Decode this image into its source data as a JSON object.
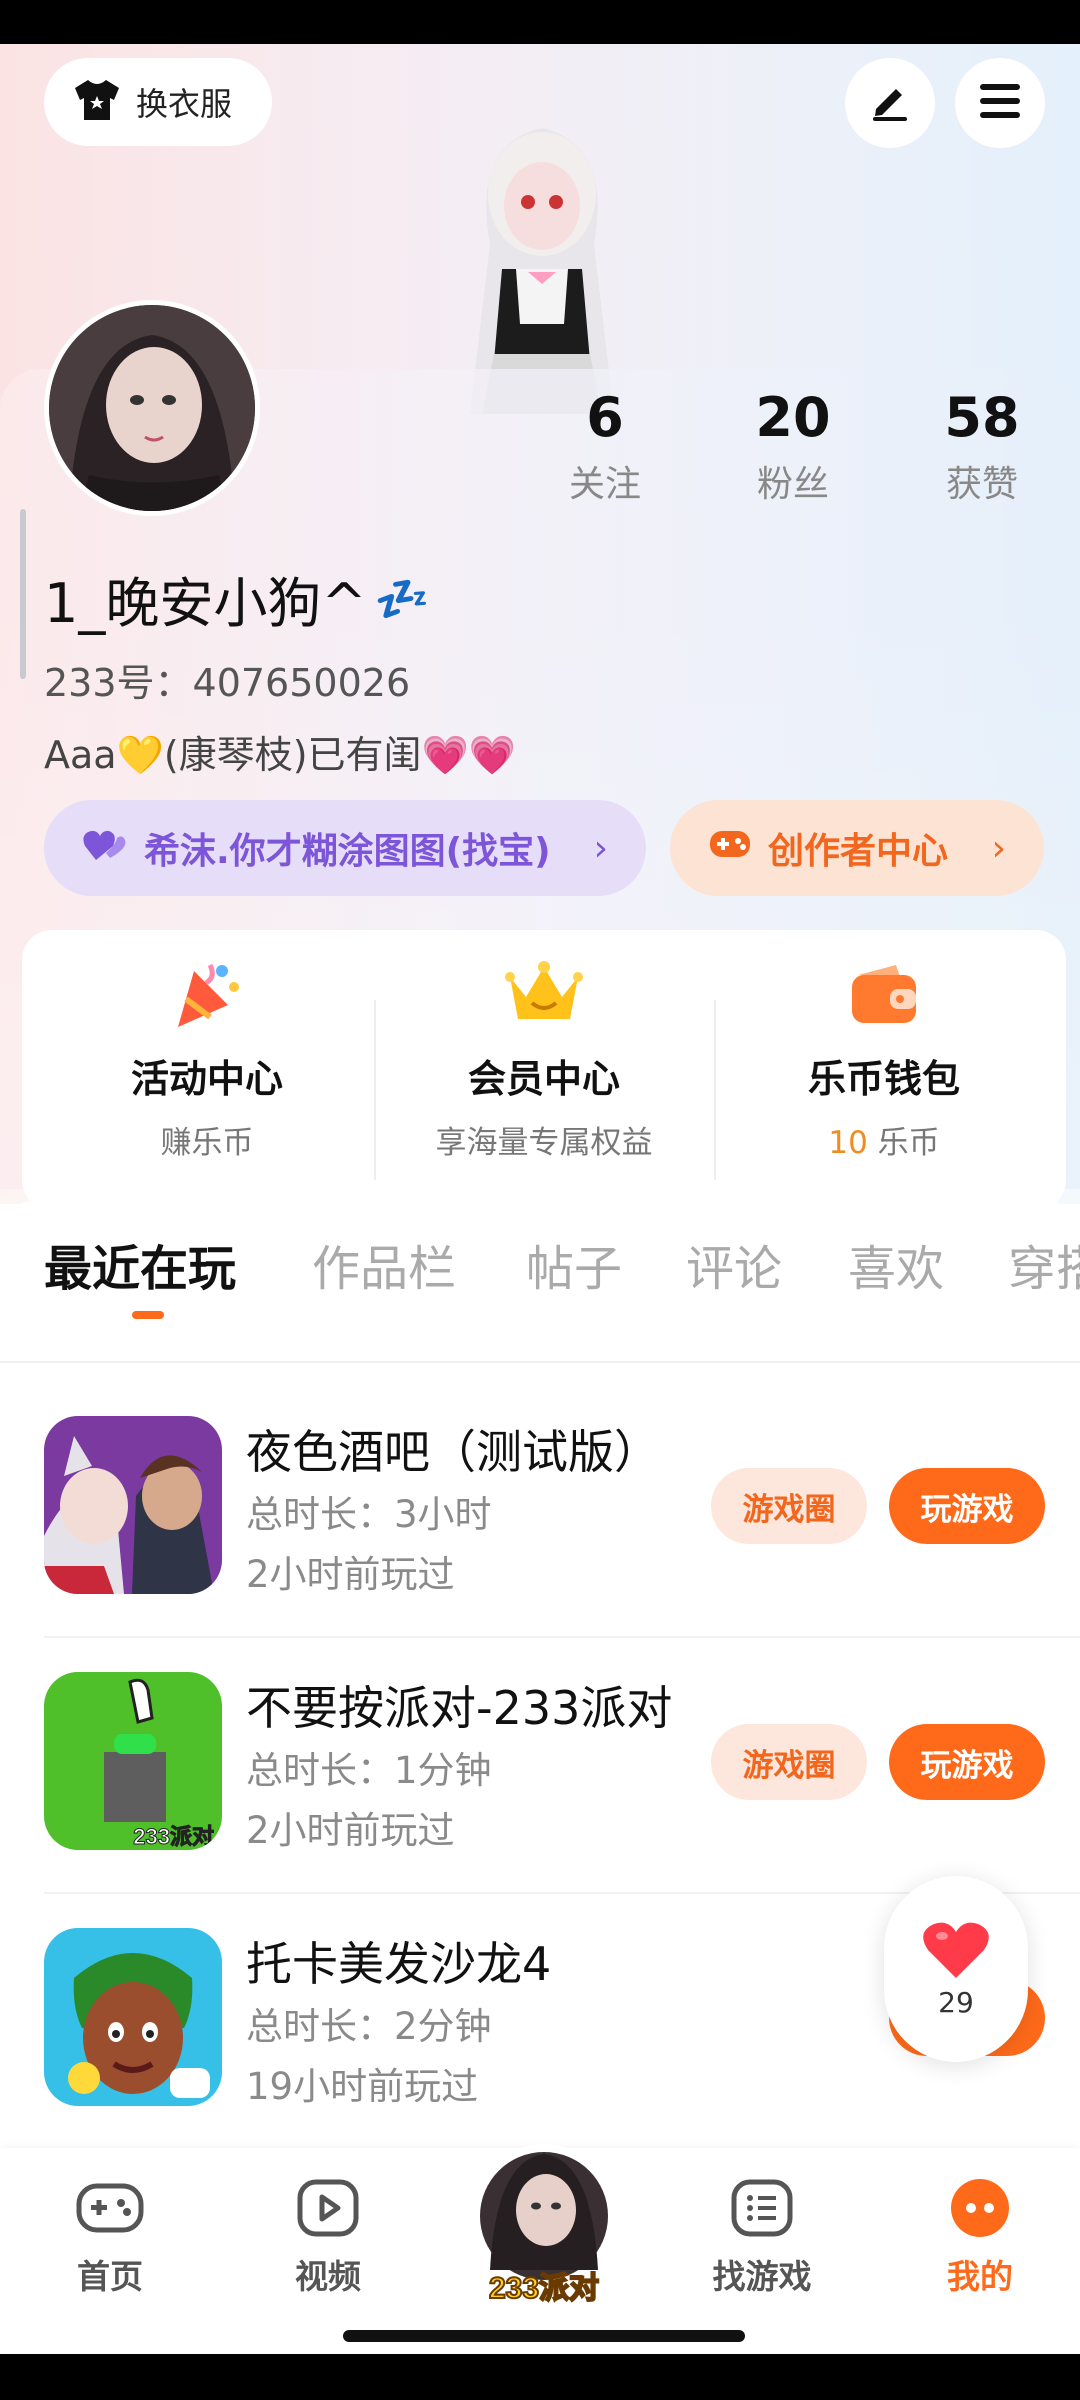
{
  "header": {
    "outfit_label": "换衣服",
    "icons": [
      "tshirt-icon",
      "edit-icon",
      "menu-icon"
    ]
  },
  "profile": {
    "stats": [
      {
        "value": "6",
        "label": "关注"
      },
      {
        "value": "20",
        "label": "粉丝"
      },
      {
        "value": "58",
        "label": "获赞"
      }
    ],
    "username": "1_晚安小狗^",
    "username_emoji": "💤",
    "uid": "233号：407650026",
    "bio": "Aaa💛(康琴枝)已有闺💗💗",
    "pill_left": "希沫.你才糊涂图图(找宝)",
    "pill_right": "创作者中心",
    "chevron": "›"
  },
  "quick_actions": [
    {
      "title": "活动中心",
      "sub": "赚乐币"
    },
    {
      "title": "会员中心",
      "sub": "享海量专属权益"
    },
    {
      "title": "乐币钱包",
      "sub_value": "10",
      "sub_unit": " 乐币"
    }
  ],
  "tabs": [
    "最近在玩",
    "作品栏",
    "帖子",
    "评论",
    "喜欢",
    "穿搭"
  ],
  "games": [
    {
      "name": "夜色酒吧（测试版）",
      "duration": "总时长：3小时",
      "last_played": "2小时前玩过",
      "btn_circle": "游戏圈",
      "btn_play": "玩游戏"
    },
    {
      "name": "不要按派对-233派对",
      "duration": "总时长：1分钟",
      "last_played": "2小时前玩过",
      "btn_circle": "游戏圈",
      "btn_play": "玩游戏",
      "icon_text": "233派对"
    },
    {
      "name": "托卡美发沙龙4",
      "duration": "总时长：2分钟",
      "last_played": "19小时前玩过"
    }
  ],
  "like": {
    "count": "29"
  },
  "nav": [
    {
      "label": "首页"
    },
    {
      "label": "视频"
    },
    {
      "label": "233派对"
    },
    {
      "label": "找游戏"
    },
    {
      "label": "我的"
    }
  ],
  "colors": {
    "accent": "#ff6a1a",
    "purple": "#7c55d8"
  }
}
